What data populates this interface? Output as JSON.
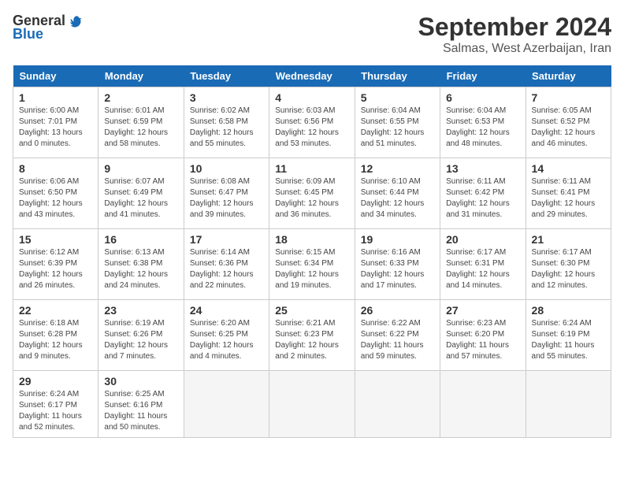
{
  "logo": {
    "general": "General",
    "blue": "Blue"
  },
  "title": "September 2024",
  "location": "Salmas, West Azerbaijan, Iran",
  "days_of_week": [
    "Sunday",
    "Monday",
    "Tuesday",
    "Wednesday",
    "Thursday",
    "Friday",
    "Saturday"
  ],
  "weeks": [
    [
      {
        "day": "1",
        "info": "Sunrise: 6:00 AM\nSunset: 7:01 PM\nDaylight: 13 hours\nand 0 minutes."
      },
      {
        "day": "2",
        "info": "Sunrise: 6:01 AM\nSunset: 6:59 PM\nDaylight: 12 hours\nand 58 minutes."
      },
      {
        "day": "3",
        "info": "Sunrise: 6:02 AM\nSunset: 6:58 PM\nDaylight: 12 hours\nand 55 minutes."
      },
      {
        "day": "4",
        "info": "Sunrise: 6:03 AM\nSunset: 6:56 PM\nDaylight: 12 hours\nand 53 minutes."
      },
      {
        "day": "5",
        "info": "Sunrise: 6:04 AM\nSunset: 6:55 PM\nDaylight: 12 hours\nand 51 minutes."
      },
      {
        "day": "6",
        "info": "Sunrise: 6:04 AM\nSunset: 6:53 PM\nDaylight: 12 hours\nand 48 minutes."
      },
      {
        "day": "7",
        "info": "Sunrise: 6:05 AM\nSunset: 6:52 PM\nDaylight: 12 hours\nand 46 minutes."
      }
    ],
    [
      {
        "day": "8",
        "info": "Sunrise: 6:06 AM\nSunset: 6:50 PM\nDaylight: 12 hours\nand 43 minutes."
      },
      {
        "day": "9",
        "info": "Sunrise: 6:07 AM\nSunset: 6:49 PM\nDaylight: 12 hours\nand 41 minutes."
      },
      {
        "day": "10",
        "info": "Sunrise: 6:08 AM\nSunset: 6:47 PM\nDaylight: 12 hours\nand 39 minutes."
      },
      {
        "day": "11",
        "info": "Sunrise: 6:09 AM\nSunset: 6:45 PM\nDaylight: 12 hours\nand 36 minutes."
      },
      {
        "day": "12",
        "info": "Sunrise: 6:10 AM\nSunset: 6:44 PM\nDaylight: 12 hours\nand 34 minutes."
      },
      {
        "day": "13",
        "info": "Sunrise: 6:11 AM\nSunset: 6:42 PM\nDaylight: 12 hours\nand 31 minutes."
      },
      {
        "day": "14",
        "info": "Sunrise: 6:11 AM\nSunset: 6:41 PM\nDaylight: 12 hours\nand 29 minutes."
      }
    ],
    [
      {
        "day": "15",
        "info": "Sunrise: 6:12 AM\nSunset: 6:39 PM\nDaylight: 12 hours\nand 26 minutes."
      },
      {
        "day": "16",
        "info": "Sunrise: 6:13 AM\nSunset: 6:38 PM\nDaylight: 12 hours\nand 24 minutes."
      },
      {
        "day": "17",
        "info": "Sunrise: 6:14 AM\nSunset: 6:36 PM\nDaylight: 12 hours\nand 22 minutes."
      },
      {
        "day": "18",
        "info": "Sunrise: 6:15 AM\nSunset: 6:34 PM\nDaylight: 12 hours\nand 19 minutes."
      },
      {
        "day": "19",
        "info": "Sunrise: 6:16 AM\nSunset: 6:33 PM\nDaylight: 12 hours\nand 17 minutes."
      },
      {
        "day": "20",
        "info": "Sunrise: 6:17 AM\nSunset: 6:31 PM\nDaylight: 12 hours\nand 14 minutes."
      },
      {
        "day": "21",
        "info": "Sunrise: 6:17 AM\nSunset: 6:30 PM\nDaylight: 12 hours\nand 12 minutes."
      }
    ],
    [
      {
        "day": "22",
        "info": "Sunrise: 6:18 AM\nSunset: 6:28 PM\nDaylight: 12 hours\nand 9 minutes."
      },
      {
        "day": "23",
        "info": "Sunrise: 6:19 AM\nSunset: 6:26 PM\nDaylight: 12 hours\nand 7 minutes."
      },
      {
        "day": "24",
        "info": "Sunrise: 6:20 AM\nSunset: 6:25 PM\nDaylight: 12 hours\nand 4 minutes."
      },
      {
        "day": "25",
        "info": "Sunrise: 6:21 AM\nSunset: 6:23 PM\nDaylight: 12 hours\nand 2 minutes."
      },
      {
        "day": "26",
        "info": "Sunrise: 6:22 AM\nSunset: 6:22 PM\nDaylight: 11 hours\nand 59 minutes."
      },
      {
        "day": "27",
        "info": "Sunrise: 6:23 AM\nSunset: 6:20 PM\nDaylight: 11 hours\nand 57 minutes."
      },
      {
        "day": "28",
        "info": "Sunrise: 6:24 AM\nSunset: 6:19 PM\nDaylight: 11 hours\nand 55 minutes."
      }
    ],
    [
      {
        "day": "29",
        "info": "Sunrise: 6:24 AM\nSunset: 6:17 PM\nDaylight: 11 hours\nand 52 minutes."
      },
      {
        "day": "30",
        "info": "Sunrise: 6:25 AM\nSunset: 6:16 PM\nDaylight: 11 hours\nand 50 minutes."
      },
      {
        "day": "",
        "info": ""
      },
      {
        "day": "",
        "info": ""
      },
      {
        "day": "",
        "info": ""
      },
      {
        "day": "",
        "info": ""
      },
      {
        "day": "",
        "info": ""
      }
    ]
  ]
}
